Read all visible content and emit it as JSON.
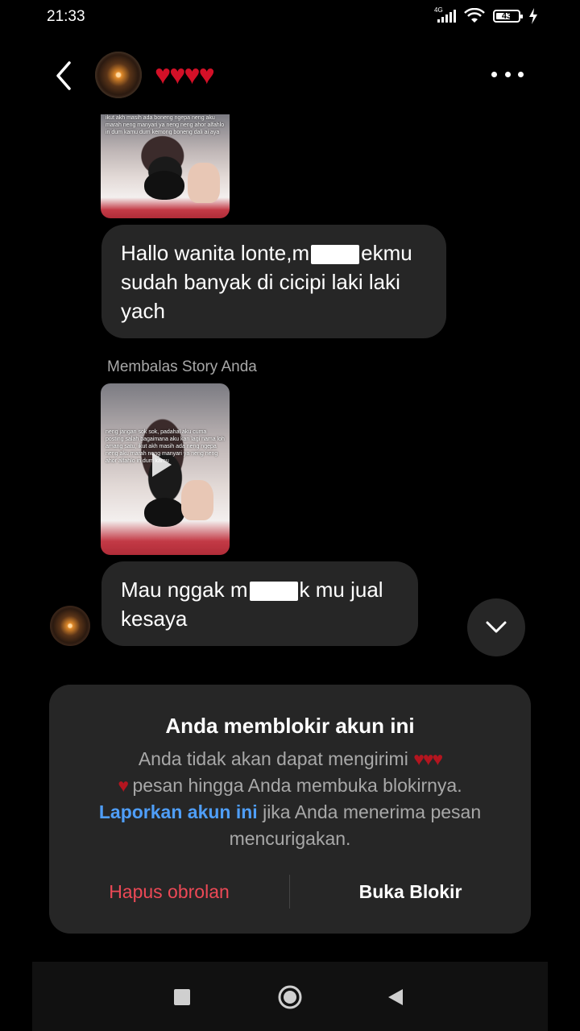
{
  "status_bar": {
    "time": "21:33",
    "network": "4G",
    "battery": "43"
  },
  "header": {
    "contact_name": "♥♥♥♥"
  },
  "messages": [
    {
      "type": "story",
      "overlay_text": "ikut akh masih ada boneng ngepa neng aku marah neng manyari ya neng neng ahor alfahlo in dum kamu dum kemong boneng dali ai aya"
    },
    {
      "type": "text",
      "parts": [
        "Hallo wanita lonte,m",
        "ekmu sudah banyak di cicipi laki laki yach"
      ]
    },
    {
      "type": "caption",
      "text": "Membalas Story Anda"
    },
    {
      "type": "story",
      "overlay_text": "neng jangan sok sok, padahal aku cuma posting salah bagaimana aku kan lagi nama loh amang satu, ikut akh masih ada neng ngepa neng aku marah neng manyari ya neng neng ahor alfahlo in dum kamu"
    },
    {
      "type": "text",
      "parts": [
        "Mau nggak m",
        "k mu jual kesaya"
      ]
    }
  ],
  "blocked_panel": {
    "title": "Anda memblokir akun ini",
    "desc_part1": "Anda tidak akan dapat mengirimi",
    "desc_hearts1": "♥♥♥",
    "desc_hearts2": "♥",
    "desc_part2": "pesan hingga Anda membuka blokirnya.",
    "report_link": "Laporkan akun ini",
    "desc_part3": "jika Anda menerima pesan mencurigakan.",
    "delete_label": "Hapus obrolan",
    "unblock_label": "Buka Blokir"
  },
  "colors": {
    "background": "#000000",
    "bubble": "#262626",
    "link": "#4f9ef8",
    "danger": "#ed4956",
    "heart": "#d31027"
  }
}
